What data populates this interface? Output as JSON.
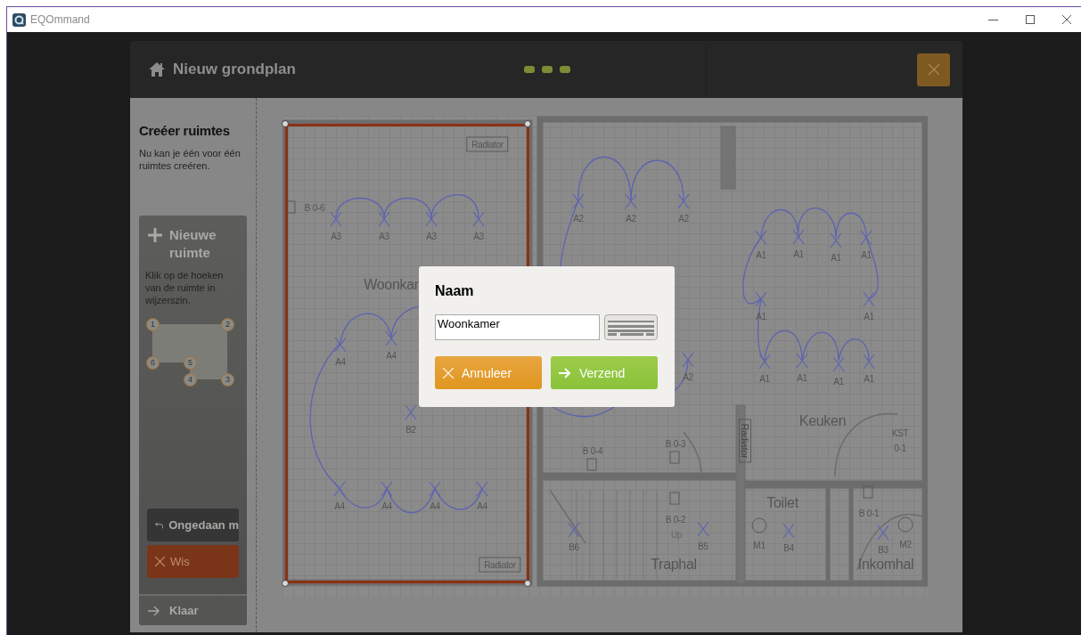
{
  "window": {
    "title": "EQOmmand"
  },
  "header": {
    "title": "Nieuw grondplan"
  },
  "sidebar": {
    "heading": "Creéer ruimtes",
    "description": "Nu kan je één voor één ruimtes creéren.",
    "new_room": {
      "title": "Nieuwe ruimte",
      "instructions": "Klik op de hoeken van de ruimte in wijzerszin.",
      "corners": [
        "1",
        "2",
        "3",
        "4",
        "5",
        "6"
      ]
    },
    "buttons": [
      {
        "kind": "undo",
        "label": "Ongedaan m"
      },
      {
        "kind": "clear",
        "label": "Wis"
      }
    ],
    "done_button": "Klaar"
  },
  "floor_plan": {
    "labels": [
      {
        "kind": "radiator",
        "text": "Radiator"
      },
      {
        "kind": "outlet",
        "text": "B 0-6"
      },
      {
        "kind": "fixture",
        "text": "A3"
      },
      {
        "kind": "fixture",
        "text": "A3"
      },
      {
        "kind": "fixture",
        "text": "A3"
      },
      {
        "kind": "fixture",
        "text": "A3"
      },
      {
        "kind": "room",
        "text": "Woonkar"
      },
      {
        "kind": "fixture",
        "text": "A4"
      },
      {
        "kind": "fixture",
        "text": "A4"
      },
      {
        "kind": "fixture",
        "text": "B2"
      },
      {
        "kind": "fixture",
        "text": "A4"
      },
      {
        "kind": "fixture",
        "text": "A4"
      },
      {
        "kind": "fixture",
        "text": "A4"
      },
      {
        "kind": "fixture",
        "text": "A4"
      },
      {
        "kind": "radiator",
        "text": "Radiator"
      },
      {
        "kind": "fixture",
        "text": "A2"
      },
      {
        "kind": "fixture",
        "text": "A2"
      },
      {
        "kind": "fixture",
        "text": "A2"
      },
      {
        "kind": "fixture",
        "text": "A1"
      },
      {
        "kind": "fixture",
        "text": "A1"
      },
      {
        "kind": "fixture",
        "text": "A1"
      },
      {
        "kind": "fixture",
        "text": "A1"
      },
      {
        "kind": "fixture",
        "text": "A1"
      },
      {
        "kind": "fixture",
        "text": "A1"
      },
      {
        "kind": "fixture",
        "text": "A2"
      },
      {
        "kind": "fixture",
        "text": "A1"
      },
      {
        "kind": "fixture",
        "text": "A1"
      },
      {
        "kind": "fixture",
        "text": "A1"
      },
      {
        "kind": "fixture",
        "text": "A1"
      },
      {
        "kind": "vradiator",
        "text": "Radiator"
      },
      {
        "kind": "room",
        "text": "Keuken"
      },
      {
        "kind": "tag",
        "text": "KST"
      },
      {
        "kind": "tag",
        "text": "0-1"
      },
      {
        "kind": "outlet",
        "text": "B 0-4"
      },
      {
        "kind": "outlet",
        "text": "B 0-3"
      },
      {
        "kind": "room",
        "text": "Toilet"
      },
      {
        "kind": "outlet",
        "text": "B 0-2"
      },
      {
        "kind": "faint",
        "text": "Up"
      },
      {
        "kind": "fixture",
        "text": "B6"
      },
      {
        "kind": "fixture",
        "text": "B5"
      },
      {
        "kind": "motor",
        "text": "M1"
      },
      {
        "kind": "fixture",
        "text": "B4"
      },
      {
        "kind": "outlet",
        "text": "B 0-1"
      },
      {
        "kind": "fixture",
        "text": "B3"
      },
      {
        "kind": "motor",
        "text": "M2"
      },
      {
        "kind": "room",
        "text": "Traphal"
      },
      {
        "kind": "room",
        "text": "Inkomhal"
      }
    ]
  },
  "dialog": {
    "title": "Naam",
    "input": {
      "value": "Woonkamer"
    },
    "buttons": [
      {
        "kind": "cancel",
        "label": "Annuleer"
      },
      {
        "kind": "submit",
        "label": "Verzend"
      }
    ]
  }
}
